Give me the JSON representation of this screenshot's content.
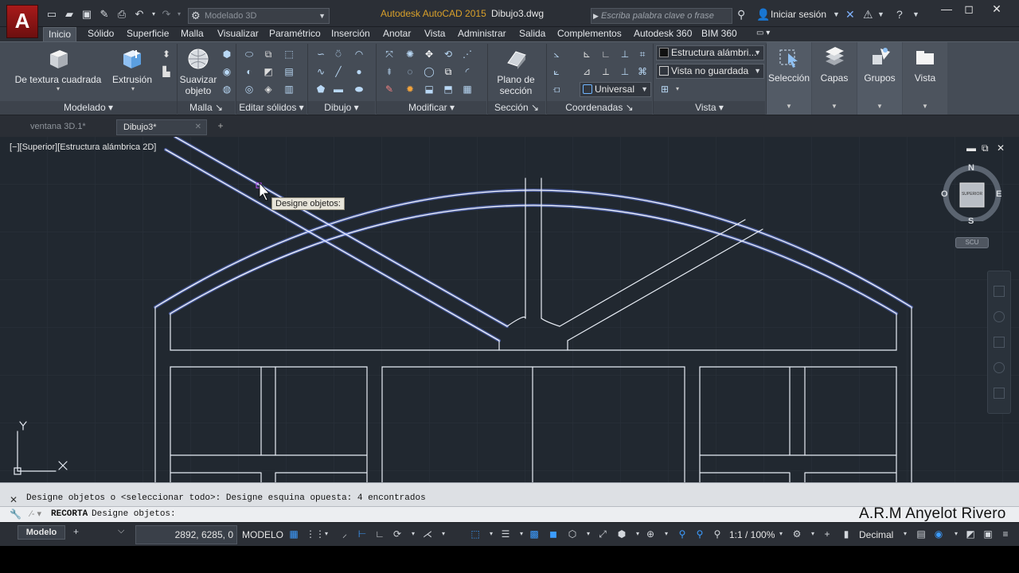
{
  "titlebar": {
    "app_logo": "A",
    "workspace": "Modelado 3D",
    "app_title": "Autodesk AutoCAD 2015",
    "file_title": "Dibujo3.dwg",
    "search_placeholder": "Escriba palabra clave o frase",
    "signin": "Iniciar sesión"
  },
  "ribbon_tabs": [
    "Inicio",
    "Sólido",
    "Superficie",
    "Malla",
    "Visualizar",
    "Paramétrico",
    "Inserción",
    "Anotar",
    "Vista",
    "Administrar",
    "Salida",
    "Complementos",
    "Autodesk 360",
    "BIM 360"
  ],
  "ribbon": {
    "modelado": {
      "tool1": "De textura cuadrada",
      "tool2": "Extrusión",
      "title": "Modelado"
    },
    "malla": {
      "tool1": "Suavizar objeto",
      "title": "Malla"
    },
    "editar_solidos": {
      "title": "Editar sólidos"
    },
    "dibujo": {
      "title": "Dibujo"
    },
    "modificar": {
      "title": "Modificar"
    },
    "seccion": {
      "tool1": "Plano de sección",
      "title": "Sección"
    },
    "coordenadas": {
      "title": "Coordenadas",
      "ucs_select": "Universal"
    },
    "vista": {
      "visual_style": "Estructura alámbri...",
      "saved_view": "Vista no guardada",
      "title": "Vista"
    },
    "right_tools": [
      "Selección",
      "Capas",
      "Grupos",
      "Vista"
    ]
  },
  "file_tabs": [
    {
      "label": "ventana 3D.1*"
    },
    {
      "label": "Dibujo3*"
    }
  ],
  "viewport": {
    "label": "[−][Superior][Estructura alámbrica 2D]",
    "tooltip": "Designe objetos:",
    "viewcube": {
      "n": "N",
      "s": "S",
      "e": "E",
      "o": "O",
      "face": "SUPERIOR",
      "wcs": "SCU"
    },
    "ucs": {
      "y": "Y"
    }
  },
  "command": {
    "history": "Designe objetos o <seleccionar todo>: Designe esquina opuesta: 4 encontrados",
    "name": "RECORTA",
    "prompt": "Designe objetos:"
  },
  "watermark": "A.R.M Anyelot Rivero",
  "statusbar": {
    "layout": "Modelo",
    "coords": "2892, 6285, 0",
    "mode": "MODELO",
    "annotation_scale": "1:1 / 100%",
    "units": "Decimal"
  },
  "colors": {
    "viewport_bg": "#212830",
    "drawing_lines": "#e8edf5",
    "selected_glow": "#6f8cff",
    "accent_blue": "#3c9cff",
    "app_title": "#d9a02a"
  }
}
